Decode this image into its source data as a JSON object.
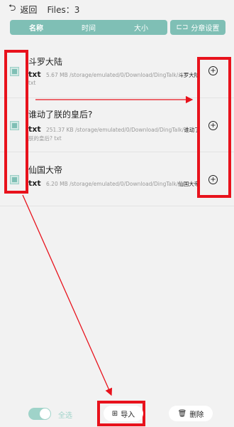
{
  "topbar": {
    "back_icon": "back-arrow-icon",
    "back_label": "返回",
    "files_label": "Files：3"
  },
  "sort": {
    "tabs": [
      "名称",
      "时间",
      "大小"
    ],
    "settings_label": "分章设置",
    "settings_icon": "split-icon"
  },
  "files": [
    {
      "title": "斗罗大陆",
      "ext": "txt",
      "size": "5.67 MB",
      "path": "/storage/emulated/0/Download/DingTalk/",
      "path_tail": "斗罗大陆",
      "sub": "txt"
    },
    {
      "title": "谁动了朕的皇后?",
      "ext": "txt",
      "size": "251.37 KB",
      "path": "/storage/emulated/0/Download/DingTalk/",
      "path_tail": "谁动了",
      "sub": "朕的皇后?  txt"
    },
    {
      "title": "仙国大帝",
      "ext": "txt",
      "size": "6.20 MB",
      "path": "/storage/emulated/0/Download/DingTalk/",
      "path_tail": "仙国大帝",
      "sub": ""
    }
  ],
  "bottom": {
    "select_all_label": "全选",
    "import_label": "导入",
    "import_icon": "folder-plus-icon",
    "delete_label": "删除",
    "delete_icon": "trash-icon"
  },
  "colors": {
    "accent": "#7fbfb5",
    "annotation_red": "#e8121c"
  }
}
